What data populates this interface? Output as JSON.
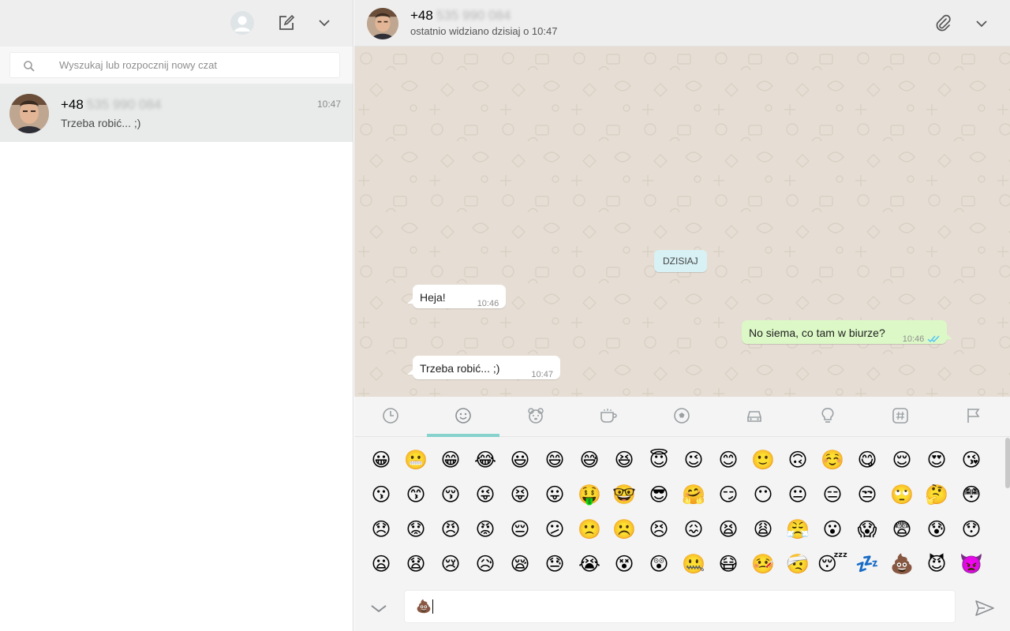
{
  "left_panel": {
    "search": {
      "placeholder": "Wyszukaj lub rozpocznij nowy czat"
    },
    "chats": [
      {
        "name_prefix": "+48",
        "name_blurred": "535 990 084",
        "time": "10:47",
        "preview": "Trzeba robić... ;)"
      }
    ]
  },
  "conversation": {
    "header": {
      "name_prefix": "+48",
      "name_blurred": "535 990 084",
      "status": "ostatnio widziano dzisiaj o 10:47"
    },
    "day_badge": "DZISIAJ",
    "messages": [
      {
        "direction": "in",
        "text": "Heja!",
        "time": "10:46"
      },
      {
        "direction": "out",
        "text": "No siema, co tam w biurze?",
        "time": "10:46",
        "read": true
      },
      {
        "direction": "in",
        "text": "Trzeba robić... ;)",
        "time": "10:47"
      }
    ]
  },
  "emoji_panel": {
    "active_tab": "smileys",
    "tabs": [
      "recent-clock-icon",
      "smiley-icon",
      "animal-icon",
      "food-cup-icon",
      "ball-icon",
      "car-icon",
      "bulb-icon",
      "hash-icon",
      "flag-icon"
    ],
    "rows": [
      [
        "😀",
        "😬",
        "😁",
        "😂",
        "😃",
        "😄",
        "😅",
        "😆",
        "😇",
        "😉",
        "😊",
        "🙂",
        "🙃",
        "☺️",
        "😋",
        "😌",
        "😍",
        "😘"
      ],
      [
        "😗",
        "😙",
        "😚",
        "😜",
        "😝",
        "😛",
        "🤑",
        "🤓",
        "😎",
        "🤗",
        "😏",
        "😶",
        "😐",
        "😑",
        "😒",
        "🙄",
        "🤔",
        "😳"
      ],
      [
        "😞",
        "😟",
        "😠",
        "😡",
        "😔",
        "😕",
        "🙁",
        "☹️",
        "😣",
        "😖",
        "😫",
        "😩",
        "😤",
        "😮",
        "😱",
        "😨",
        "😰",
        "😯"
      ],
      [
        "😦",
        "😧",
        "😢",
        "😥",
        "😪",
        "😓",
        "😭",
        "😵",
        "😲",
        "🤐",
        "😷",
        "🤒",
        "🤕",
        "😴",
        "💤",
        "💩",
        "😈",
        "👿"
      ]
    ]
  },
  "composer": {
    "value": "💩"
  },
  "colors": {
    "header_bg": "#eeeeee",
    "outgoing_bubble": "#dcf8c6",
    "wallpaper": "#e6ded4",
    "tab_accent": "#86d2cd",
    "read_ticks": "#4fc3f7"
  }
}
